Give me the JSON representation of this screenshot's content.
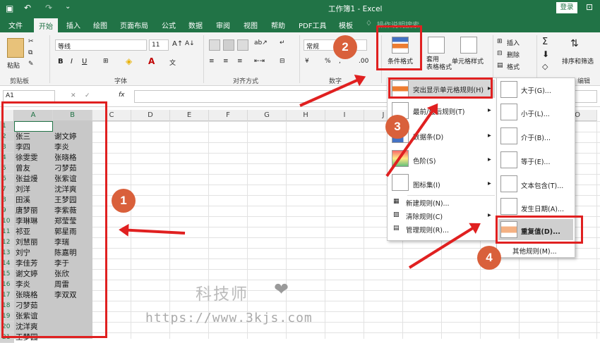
{
  "app": {
    "title": "工作簿1 - Excel",
    "login": "登录"
  },
  "tabs": [
    "文件",
    "开始",
    "插入",
    "绘图",
    "页面布局",
    "公式",
    "数据",
    "审阅",
    "视图",
    "帮助",
    "PDF工具",
    "模板",
    "操作说明搜索"
  ],
  "ribbon": {
    "clipboard": {
      "label": "剪贴板",
      "paste": "粘贴"
    },
    "font": {
      "label": "字体",
      "name": "等线",
      "size": "11",
      "bold": "B",
      "italic": "I",
      "underline": "U"
    },
    "align": {
      "label": "对齐方式"
    },
    "number": {
      "label": "数字",
      "format": "常规",
      "percent": "%"
    },
    "styles": {
      "cond_format": "条件格式",
      "as_table": "套用\n表格格式",
      "cell_styles": "单元格样式"
    },
    "cells": {
      "insert": "插入",
      "delete": "删除",
      "format": "格式"
    },
    "edit": {
      "label": "编辑",
      "sort": "排序和筛选"
    }
  },
  "formula": {
    "namebox": "A1",
    "fx": "fx"
  },
  "columns": [
    "A",
    "B",
    "C",
    "D",
    "E",
    "F",
    "G",
    "H",
    "I",
    "J",
    "K",
    "L",
    "M",
    "N",
    "O"
  ],
  "rows": [
    "1",
    "2",
    "3",
    "4",
    "5",
    "6",
    "7",
    "8",
    "9",
    "10",
    "11",
    "12",
    "13",
    "14",
    "15",
    "16",
    "17",
    "18",
    "19",
    "20",
    "21"
  ],
  "colA": [
    "",
    "张三",
    "李四",
    "徐雯雯",
    "曾友",
    "张益熳",
    "刘洋",
    "田溪",
    "唐梦丽",
    "李琳琳",
    "祁亚",
    "刘慧丽",
    "刘宁",
    "李佳芳",
    "谢文婷",
    "李炎",
    "张晓格",
    "刁梦茹",
    "张紫谊",
    "沈洋爽",
    "王梦园"
  ],
  "colB": [
    "",
    "谢文婷",
    "李炎",
    "张晓格",
    "刁梦茹",
    "张紫谊",
    "沈洋爽",
    "王梦园",
    "李紫薇",
    "郑莹莹",
    "郭星雨",
    "李瑞",
    "陈嘉明",
    "李于",
    "张欣",
    "周雷",
    "李双双",
    "",
    "",
    "",
    ""
  ],
  "menu1": [
    {
      "label": "突出显示单元格规则(H)",
      "arrow": "▸"
    },
    {
      "label": "最前/最后规则(T)",
      "arrow": "▸"
    },
    {
      "label": "数据条(D)",
      "arrow": "▸"
    },
    {
      "label": "色阶(S)",
      "arrow": "▸"
    },
    {
      "label": "图标集(I)",
      "arrow": "▸"
    },
    {
      "label": "新建规则(N)...",
      "arrow": ""
    },
    {
      "label": "清除规则(C)",
      "arrow": "▸"
    },
    {
      "label": "管理规则(R)...",
      "arrow": ""
    }
  ],
  "menu2": [
    {
      "label": "大于(G)..."
    },
    {
      "label": "小于(L)..."
    },
    {
      "label": "介于(B)..."
    },
    {
      "label": "等于(E)..."
    },
    {
      "label": "文本包含(T)..."
    },
    {
      "label": "发生日期(A)..."
    },
    {
      "label": "重复值(D)..."
    },
    {
      "label": "其他规则(M)..."
    }
  ],
  "badges": [
    "1",
    "2",
    "3",
    "4"
  ],
  "watermark": {
    "name": "科技师",
    "url": "https://www.3kjs.com"
  },
  "colors": {
    "excel_green": "#217346",
    "annotation_red": "#e02020",
    "badge_orange": "#d9603b",
    "selection_gray": "#c8c8c8"
  }
}
